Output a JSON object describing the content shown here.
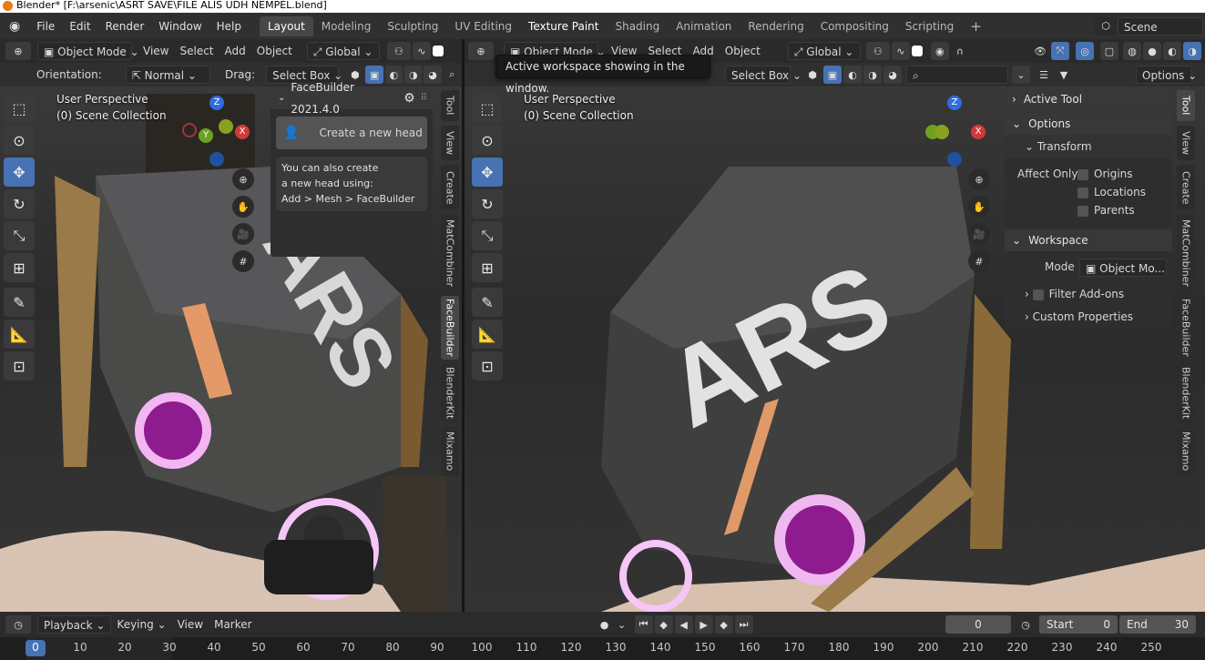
{
  "title_bar": {
    "text": "Blender* [F:\\arsenic\\ASRT SAVE\\FILE ALIS UDH NEMPEL.blend]"
  },
  "menu": {
    "items": [
      "File",
      "Edit",
      "Render",
      "Window",
      "Help"
    ]
  },
  "workspace_tabs": {
    "tabs": [
      "Layout",
      "Modeling",
      "Sculpting",
      "UV Editing",
      "Texture Paint",
      "Shading",
      "Animation",
      "Rendering",
      "Compositing",
      "Scripting"
    ],
    "active": "Layout",
    "add_label": "+"
  },
  "scene": {
    "label": "Scene"
  },
  "tooltip": {
    "text": "Active workspace showing in the window."
  },
  "left_viewport": {
    "header": {
      "mode": "Object Mode",
      "menus": [
        "View",
        "Select",
        "Add",
        "Object"
      ],
      "transform": "Global"
    },
    "tool_settings": {
      "orientation_label": "Orientation:",
      "orientation_value": "Normal",
      "drag_label": "Drag:",
      "drag_value": "Select Box"
    },
    "overlay": {
      "perspective": "User Perspective",
      "collection": "(0) Scene Collection"
    },
    "gizmo": {
      "z": "Z",
      "y": "Y",
      "x": "X"
    },
    "facebuilder": {
      "title": "FaceBuilder 2021.4.0",
      "button": "Create a new head",
      "hint_lines": [
        "You can also create",
        "a new head using:",
        "Add > Mesh > FaceBuilder"
      ]
    },
    "side_tabs": [
      "Tool",
      "View",
      "Create",
      "MatCombiner",
      "FaceBuilder",
      "BlenderKit",
      "Mixamo"
    ],
    "active_side_tab": "FaceBuilder",
    "model_text": "ARS"
  },
  "right_viewport": {
    "header": {
      "mode": "Object Mode",
      "menus": [
        "View",
        "Select",
        "Add",
        "Object"
      ],
      "transform": "Global"
    },
    "tool_settings": {
      "drag_value": "Select Box",
      "options_label": "Options"
    },
    "overlay": {
      "perspective": "User Perspective",
      "collection": "(0) Scene Collection"
    },
    "gizmo": {
      "z": "Z",
      "x": "X"
    },
    "sidebar": {
      "active_tool": "Active Tool",
      "options": "Options",
      "transform": "Transform",
      "affect_only": "Affect Only",
      "affect_items": [
        "Origins",
        "Locations",
        "Parents"
      ],
      "workspace": "Workspace",
      "mode_label": "Mode",
      "mode_value": "Object Mo...",
      "filter_addons": "Filter Add-ons",
      "custom_properties": "Custom Properties"
    },
    "side_tabs": [
      "Tool",
      "View",
      "Create",
      "MatCombiner",
      "FaceBuilder",
      "BlenderKit",
      "Mixamo"
    ],
    "active_side_tab": "Tool",
    "model_text": "ARS"
  },
  "timeline": {
    "menus": [
      "Playback",
      "Keying",
      "View",
      "Marker"
    ],
    "current_frame": "0",
    "start_label": "Start",
    "start_value": "0",
    "end_label": "End",
    "end_value": "30",
    "ruler": [
      "0",
      "10",
      "20",
      "30",
      "40",
      "50",
      "60",
      "70",
      "80",
      "90",
      "100",
      "110",
      "120",
      "130",
      "140",
      "150",
      "160",
      "170",
      "180",
      "190",
      "200",
      "210",
      "220",
      "230",
      "240",
      "250"
    ]
  },
  "colors": {
    "accent_blue": "#4772b3",
    "header_bg": "#2a2a2a",
    "brand_orange": "#e87d0d"
  }
}
